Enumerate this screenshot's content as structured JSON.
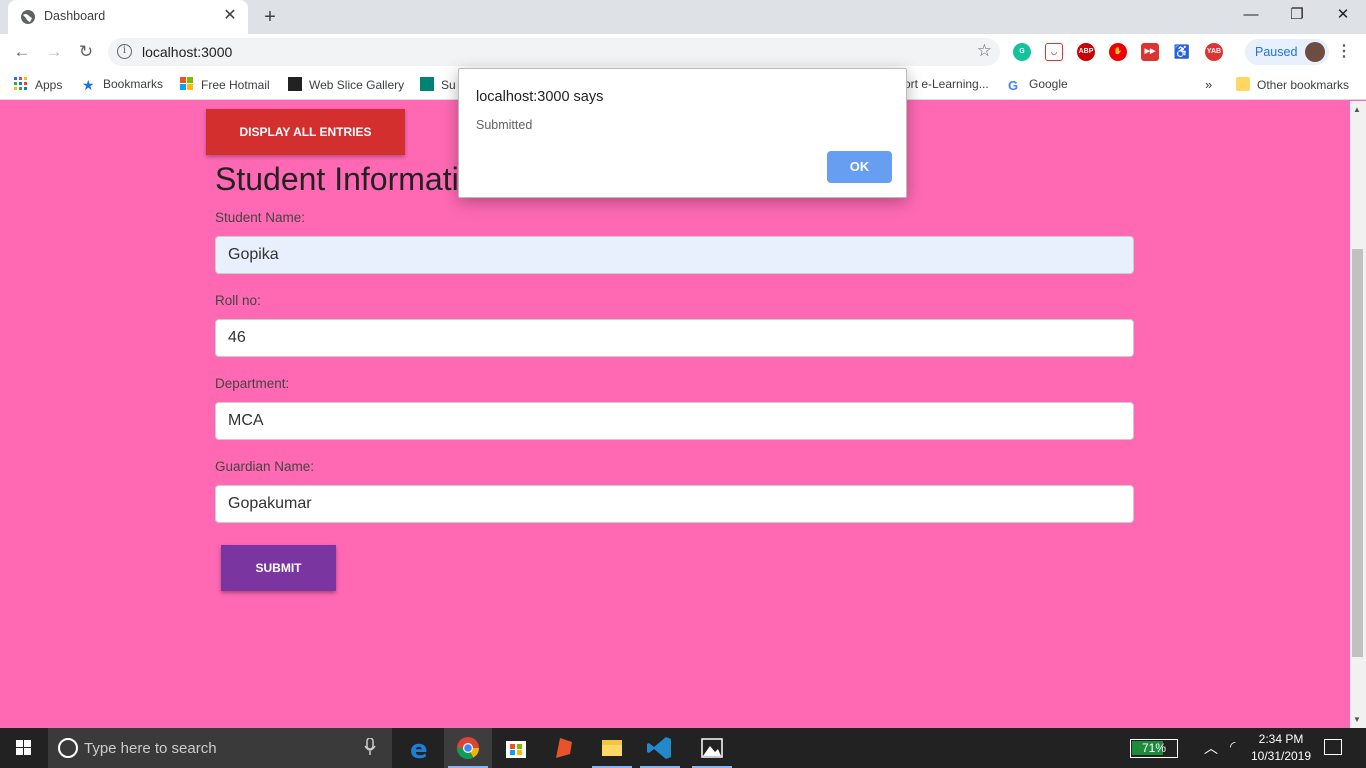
{
  "browser": {
    "tab_title": "Dashboard",
    "url": "localhost:3000",
    "profile_label": "Paused",
    "extensions": [
      "grammarly-icon",
      "pocket-icon",
      "adblock-icon",
      "stop-icon",
      "forward-icon",
      "accessibility-icon",
      "yab-icon"
    ]
  },
  "bookmarks": {
    "apps": "Apps",
    "items": [
      "Bookmarks",
      "Free Hotmail",
      "Web Slice Gallery",
      "Su",
      "ort e-Learning...",
      "Google"
    ],
    "overflow": "»",
    "other": "Other bookmarks"
  },
  "page": {
    "display_all_label": "DISPLAY ALL ENTRIES",
    "title": "Student Informati",
    "fields": [
      {
        "label": "Student Name:",
        "value": "Gopika"
      },
      {
        "label": "Roll no:",
        "value": "46"
      },
      {
        "label": "Department:",
        "value": "MCA"
      },
      {
        "label": "Guardian Name:",
        "value": "Gopakumar"
      }
    ],
    "submit_label": "SUBMIT"
  },
  "alert": {
    "heading": "localhost:3000 says",
    "message": "Submitted",
    "ok_label": "OK"
  },
  "taskbar": {
    "search_placeholder": "Type here to search",
    "battery": "71%",
    "battery_level": 0.71,
    "time": "2:34 PM",
    "date": "10/31/2019"
  },
  "colors": {
    "page_bg": "#ff69b4",
    "display_all_btn": "#d32f2f",
    "submit_btn": "#7b35a0",
    "ok_btn": "#679ef2",
    "autofill_bg": "#e8f0fe"
  }
}
